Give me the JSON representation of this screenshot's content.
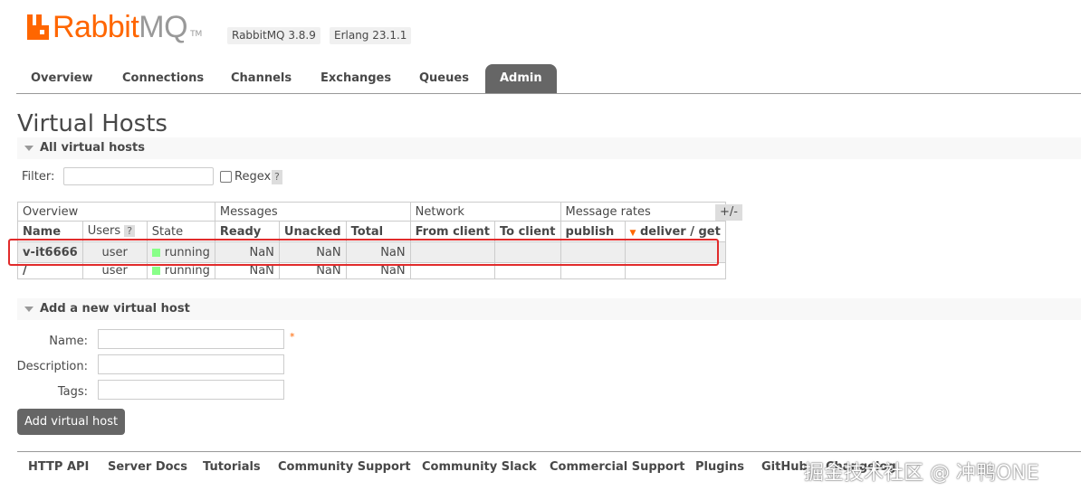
{
  "header": {
    "logo_rabbit": "Rabbit",
    "logo_mq": "MQ",
    "logo_tm": "TM",
    "version": "RabbitMQ 3.8.9",
    "erlang": "Erlang 23.1.1"
  },
  "tabs": [
    {
      "label": "Overview"
    },
    {
      "label": "Connections"
    },
    {
      "label": "Channels"
    },
    {
      "label": "Exchanges"
    },
    {
      "label": "Queues"
    },
    {
      "label": "Admin",
      "active": true
    }
  ],
  "page_title": "Virtual Hosts",
  "all_vhosts_section": "All virtual hosts",
  "filter": {
    "label": "Filter:",
    "value": "",
    "regex_label": "Regex",
    "help": "?"
  },
  "table": {
    "groups": [
      "Overview",
      "Messages",
      "Network",
      "Message rates"
    ],
    "columns": {
      "name": "Name",
      "users": "Users",
      "users_help": "?",
      "state": "State",
      "ready": "Ready",
      "unacked": "Unacked",
      "total": "Total",
      "from_client": "From client",
      "to_client": "To client",
      "publish": "publish",
      "deliver_get": "deliver / get"
    },
    "plus_minus": "+/-",
    "rows": [
      {
        "name": "v-it6666",
        "users": "user",
        "state": "running",
        "ready": "NaN",
        "unacked": "NaN",
        "total": "NaN"
      },
      {
        "name": "/",
        "users": "user",
        "state": "running",
        "ready": "NaN",
        "unacked": "NaN",
        "total": "NaN"
      }
    ]
  },
  "add_section": "Add a new virtual host",
  "form": {
    "name_label": "Name:",
    "name_required": "*",
    "description_label": "Description:",
    "tags_label": "Tags:",
    "submit": "Add virtual host"
  },
  "footer": {
    "links": [
      "HTTP API",
      "Server Docs",
      "Tutorials",
      "Community Support",
      "Community Slack",
      "Commercial Support",
      "Plugins",
      "GitHub",
      "Changelog"
    ]
  },
  "watermark": "掘金技术社区 @ 冲鸭ONE",
  "colors": {
    "accent": "#ff6600",
    "tab_active": "#666666",
    "running": "#88ff88",
    "highlight": "#e12b2b"
  }
}
